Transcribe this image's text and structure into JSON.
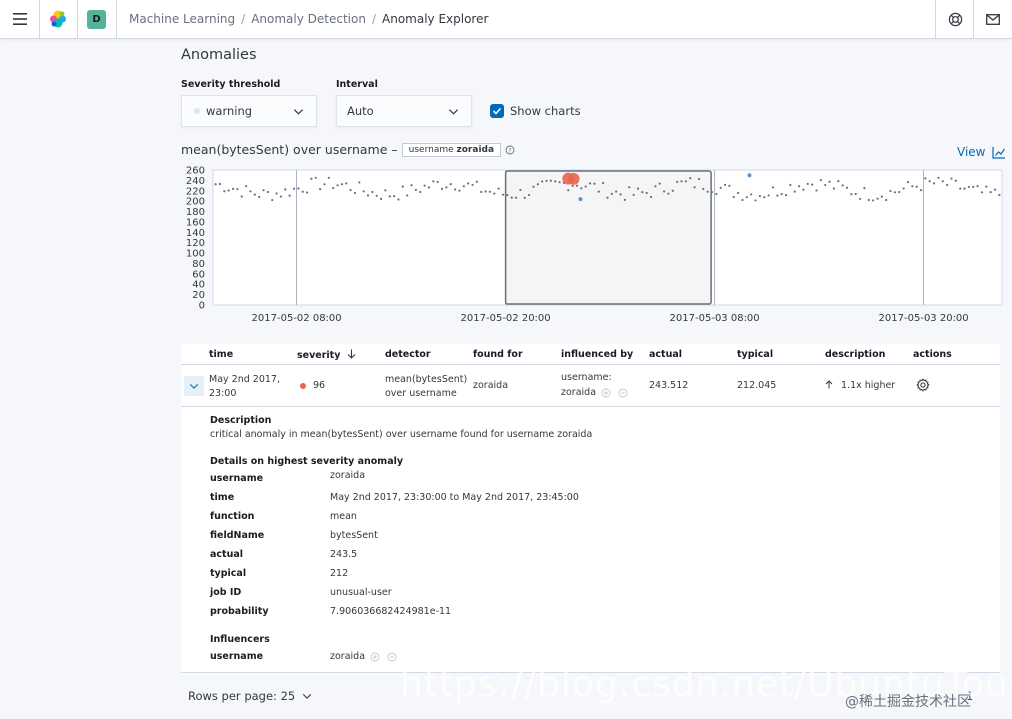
{
  "header": {
    "space_initial": "D",
    "breadcrumbs": [
      "Machine Learning",
      "Anomaly Detection",
      "Anomaly Explorer"
    ]
  },
  "page": {
    "title": "Anomalies"
  },
  "controls": {
    "severity_label": "Severity threshold",
    "severity_value": "warning",
    "interval_label": "Interval",
    "interval_value": "Auto",
    "show_charts_label": "Show charts",
    "show_charts_checked": true
  },
  "chart_panel": {
    "title_prefix": "mean(bytesSent) over username –",
    "entity_field": "username",
    "entity_value": "zoraida",
    "view_label": "View"
  },
  "chart_data": {
    "type": "scatter",
    "title": "mean(bytesSent) over username – username zoraida",
    "xlabel": "",
    "ylabel": "",
    "ylim": [
      0,
      260
    ],
    "y_ticks": [
      0,
      20,
      40,
      60,
      80,
      100,
      120,
      140,
      160,
      180,
      200,
      220,
      240,
      260
    ],
    "x_tick_labels": [
      "2017-05-02 08:00",
      "2017-05-02 20:00",
      "2017-05-03 08:00",
      "2017-05-03 20:00"
    ],
    "x_range_hours": [
      -4.8,
      40.5
    ],
    "selection_hours": [
      12.0,
      23.8
    ],
    "grid": false,
    "series_values_range": [
      195,
      245
    ],
    "anomalies": [
      {
        "x_hours": 15.6,
        "y": 243.5,
        "severity": "critical",
        "color": "#e7664c"
      },
      {
        "x_hours": 15.9,
        "y": 243,
        "severity": "critical",
        "color": "#e7664c"
      },
      {
        "x_hours": 16.3,
        "y": 204,
        "severity": "warning",
        "color": "#6092c0"
      },
      {
        "x_hours": 26.0,
        "y": 250,
        "severity": "warning",
        "color": "#6092c0"
      }
    ]
  },
  "table": {
    "headers": [
      "time",
      "severity",
      "detector",
      "found for",
      "influenced by",
      "actual",
      "typical",
      "description",
      "actions"
    ],
    "row": {
      "time_line1": "May 2nd 2017,",
      "time_line2": "23:00",
      "severity": "96",
      "detector_line1": "mean(bytesSent)",
      "detector_line2": "over username",
      "found_for": "zoraida",
      "influenced_by_line1": "username:",
      "influenced_by_line2": "zoraida",
      "actual": "243.512",
      "typical": "212.045",
      "description": "1.1x higher"
    }
  },
  "details": {
    "description_heading": "Description",
    "description_text": "critical anomaly in mean(bytesSent) over username found for username zoraida",
    "highest_heading": "Details on highest severity anomaly",
    "fields": [
      {
        "label": "username",
        "value": "zoraida"
      },
      {
        "label": "time",
        "value": "May 2nd 2017, 23:30:00 to May 2nd 2017, 23:45:00"
      },
      {
        "label": "function",
        "value": "mean"
      },
      {
        "label": "fieldName",
        "value": "bytesSent"
      },
      {
        "label": "actual",
        "value": "243.5"
      },
      {
        "label": "typical",
        "value": "212"
      },
      {
        "label": "job ID",
        "value": "unusual-user"
      },
      {
        "label": "probability",
        "value": "7.906036682424981e-11"
      }
    ],
    "influencers_heading": "Influencers",
    "influencer_label": "username",
    "influencer_value": "zoraida"
  },
  "pagination": {
    "rows_per_page_label": "Rows per page: 25",
    "current_page": "1"
  },
  "watermark": {
    "url": "https://blog.csdn.net/UbuntuTouch",
    "site": "@稀土掘金技术社区"
  }
}
